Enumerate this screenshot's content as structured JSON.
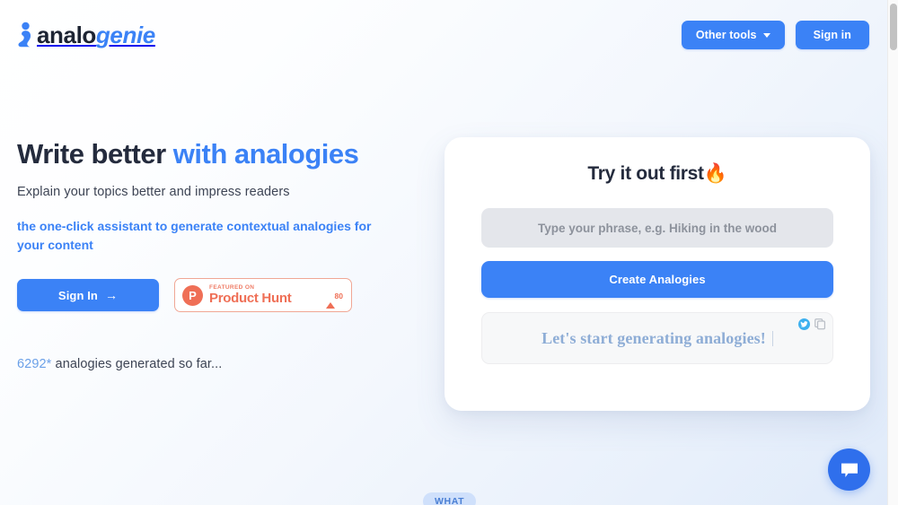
{
  "brand": {
    "logo_icon": "genie-lamp-icon",
    "name_dark": "analo",
    "name_blue": "genie",
    "accent_color": "#3b82f6",
    "dark_color": "#242b3d"
  },
  "header": {
    "other_tools_label": "Other tools",
    "sign_in_label": "Sign in",
    "dropdown_icon": "chevron-down-icon"
  },
  "hero": {
    "headline_plain": "Write better ",
    "headline_accent": "with analogies",
    "subheadline": "Explain your topics better and impress readers",
    "tagline": "the one-click assistant to generate contextual analogies for your content",
    "sign_in_label": "Sign In",
    "sign_in_arrow": "→",
    "product_hunt": {
      "logo_letter": "P",
      "featured_label": "FEATURED ON",
      "name": "Product Hunt",
      "upvote_icon": "triangle-up-icon",
      "upvote_count": "80",
      "color": "#ef6f56"
    },
    "counter_number": "6292*",
    "counter_text": " analogies generated so far..."
  },
  "try_card": {
    "title": "Try it out first🔥",
    "input_placeholder": "Type your phrase, e.g. Hiking in the wood",
    "input_value": "",
    "create_button_label": "Create Analogies",
    "result_text": "Let's start generating analogies!",
    "share_icon": "twitter-icon",
    "copy_icon": "copy-icon"
  },
  "footer_section": {
    "section_badge": "WHAT"
  },
  "chat_widget": {
    "icon": "chat-bubble-icon",
    "color": "#2f6fec"
  }
}
